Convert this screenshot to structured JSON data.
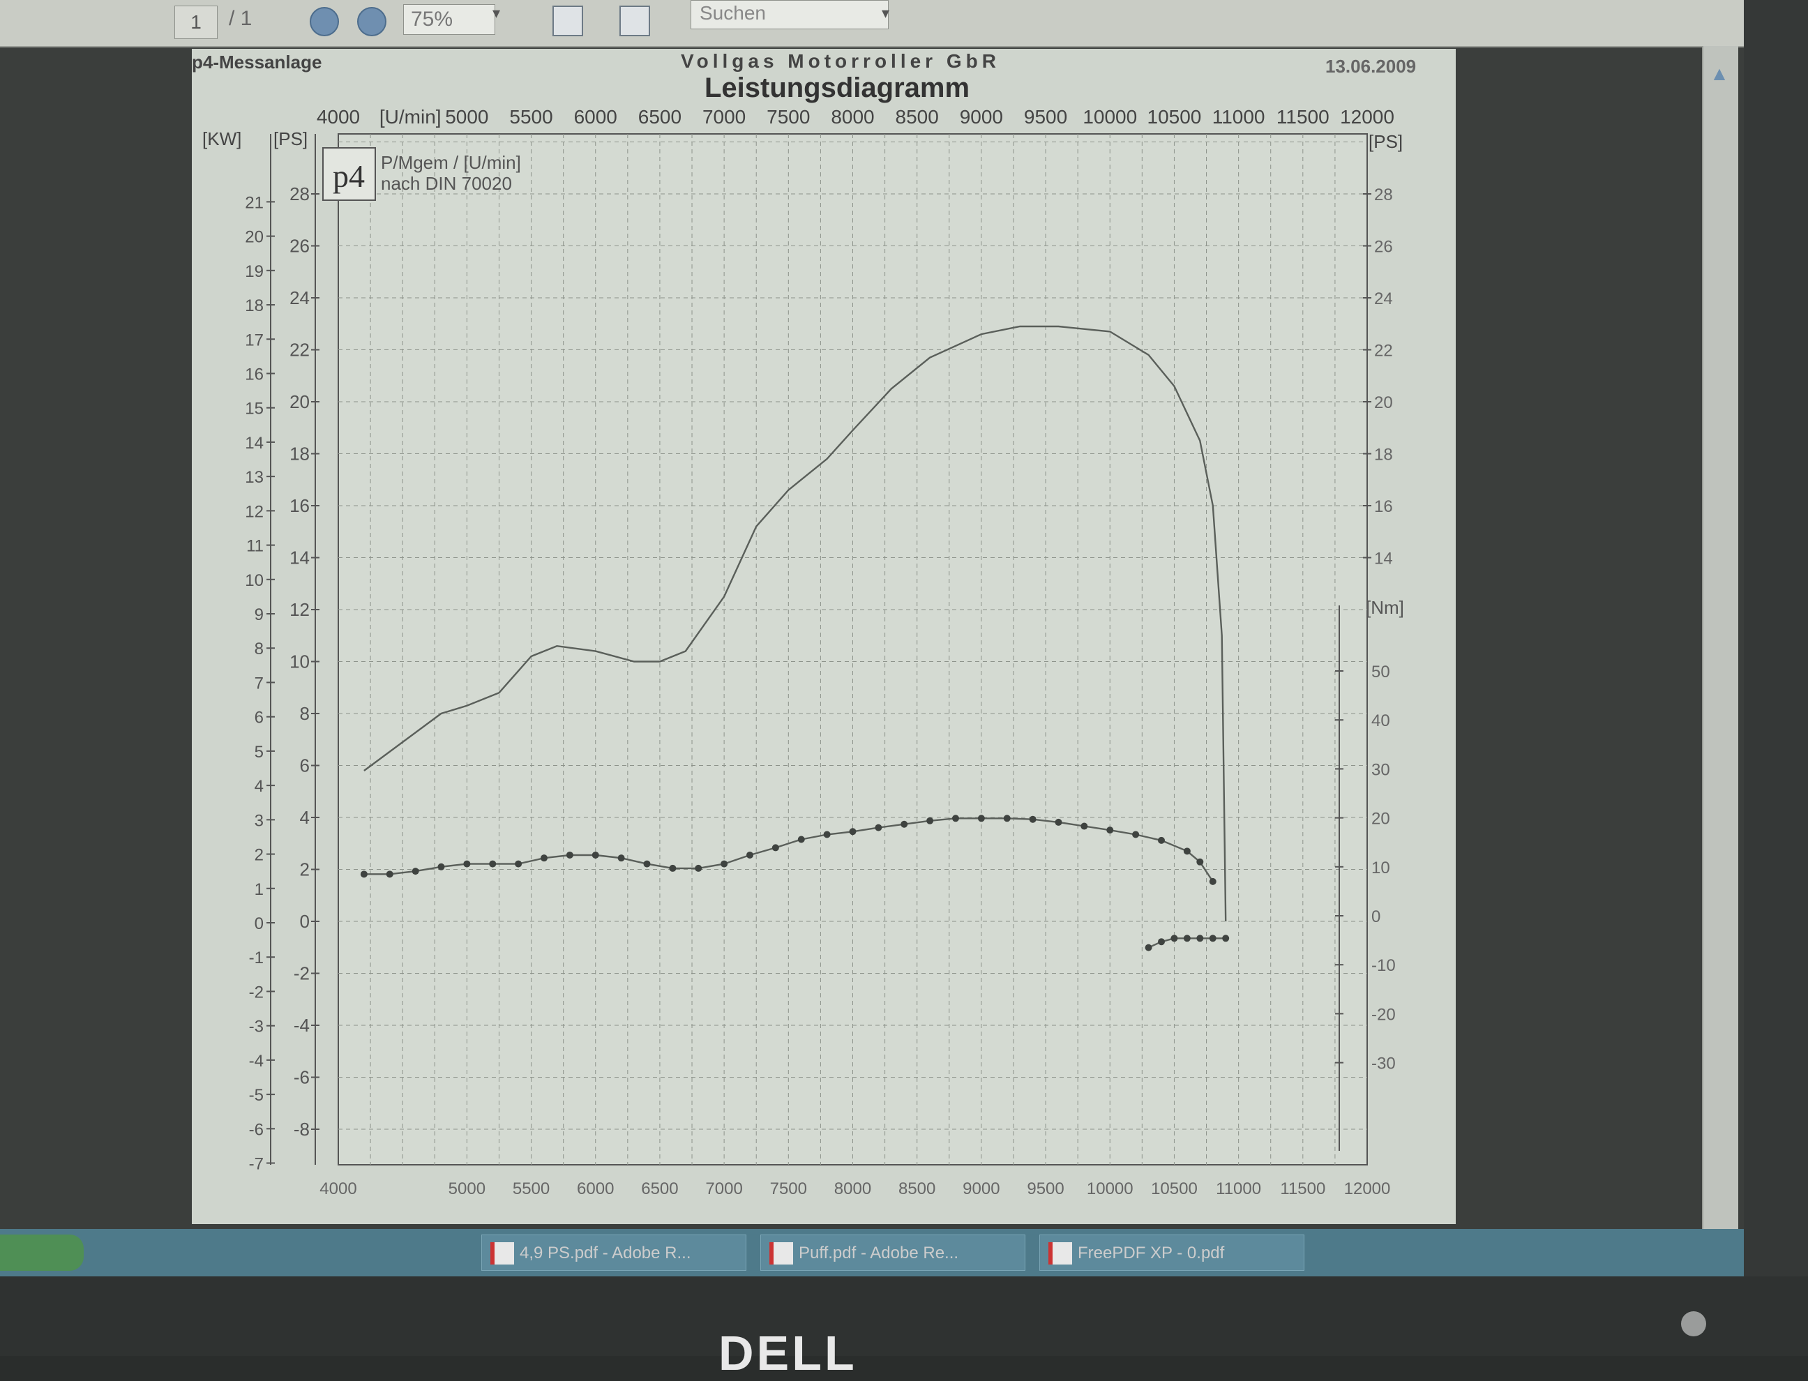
{
  "toolbar": {
    "page_current": "1",
    "page_total": "/ 1",
    "zoom": "75%",
    "search_placeholder": "Suchen"
  },
  "header": {
    "left": "p4-Messanlage",
    "center": "Vollgas Motorroller GbR",
    "date": "13.06.2009"
  },
  "chart_data": {
    "type": "line",
    "title": "Leistungsdiagramm",
    "legend_note_line1": "P/Mgem / [U/min]",
    "legend_note_line2": "nach DIN 70020",
    "logo_text": "p4",
    "x_unit": "[U/min]",
    "x_ticks": [
      "4000",
      "5000",
      "5500",
      "6000",
      "6500",
      "7000",
      "7500",
      "8000",
      "8500",
      "9000",
      "9500",
      "10000",
      "10500",
      "11000",
      "11500",
      "12000"
    ],
    "xlim": [
      4000,
      12000
    ],
    "kw_unit": "[KW]",
    "kw_ticks": [
      "21",
      "20",
      "19",
      "18",
      "17",
      "16",
      "15",
      "14",
      "13",
      "12",
      "11",
      "10",
      "9",
      "8",
      "7",
      "6",
      "5",
      "4",
      "3",
      "2",
      "1",
      "0",
      "-1",
      "-2",
      "-3",
      "-4",
      "-5",
      "-6",
      "-7"
    ],
    "ps_unit_left": "[PS]",
    "ps_ticks": [
      "28",
      "26",
      "24",
      "22",
      "20",
      "18",
      "16",
      "14",
      "12",
      "10",
      "8",
      "6",
      "4",
      "2",
      "0",
      "-2",
      "-4",
      "-6",
      "-8"
    ],
    "ps_unit_right": "[PS]",
    "ps_ticks_right": [
      "28",
      "26",
      "24",
      "22",
      "20",
      "18",
      "16",
      "14"
    ],
    "nm_unit": "[Nm]",
    "nm_ticks": [
      "50",
      "40",
      "30",
      "20",
      "10",
      "0",
      "-10",
      "-20",
      "-30"
    ],
    "grid": true,
    "series": [
      {
        "unit": "PS",
        "style": "solid",
        "x": [
          4200,
          4500,
          4800,
          5000,
          5250,
          5500,
          5700,
          6000,
          6300,
          6500,
          6700,
          7000,
          7250,
          7500,
          7800,
          8000,
          8300,
          8600,
          9000,
          9300,
          9600,
          10000,
          10300,
          10500,
          10700,
          10800,
          10870,
          10900
        ],
        "values": [
          5.8,
          6.9,
          8.0,
          8.3,
          8.8,
          10.2,
          10.6,
          10.4,
          10.0,
          10.0,
          10.4,
          12.5,
          15.2,
          16.6,
          17.8,
          18.9,
          20.5,
          21.7,
          22.6,
          22.9,
          22.9,
          22.7,
          21.8,
          20.6,
          18.5,
          16.0,
          11.0,
          0
        ]
      },
      {
        "unit": "Nm",
        "style": "dotted",
        "x": [
          4200,
          4400,
          4600,
          4800,
          5000,
          5200,
          5400,
          5600,
          5800,
          6000,
          6200,
          6400,
          6600,
          6800,
          7000,
          7200,
          7400,
          7600,
          7800,
          8000,
          8200,
          8400,
          8600,
          8800,
          9000,
          9200,
          9400,
          9600,
          9800,
          10000,
          10200,
          10400,
          10600,
          10700,
          10800
        ],
        "values": [
          8.5,
          8.5,
          9.1,
          10,
          10.6,
          10.6,
          10.6,
          11.8,
          12.4,
          12.4,
          11.8,
          10.6,
          9.7,
          9.7,
          10.6,
          12.4,
          13.9,
          15.6,
          16.6,
          17.2,
          18.0,
          18.7,
          19.4,
          19.9,
          19.9,
          19.9,
          19.7,
          19.1,
          18.3,
          17.5,
          16.6,
          15.4,
          13.2,
          11.0,
          7.0
        ]
      },
      {
        "unit": "Nm",
        "style": "dotted",
        "x": [
          10300,
          10400,
          10500,
          10600,
          10700,
          10800,
          10900
        ],
        "values": [
          -6.5,
          -5.3,
          -4.6,
          -4.6,
          -4.6,
          -4.6,
          -4.6
        ]
      }
    ]
  },
  "taskbar": {
    "items": [
      "4,9 PS.pdf - Adobe R...",
      "Puff.pdf - Adobe Re...",
      "FreePDF XP - 0.pdf"
    ]
  },
  "bezel": {
    "brand": "DELL"
  }
}
